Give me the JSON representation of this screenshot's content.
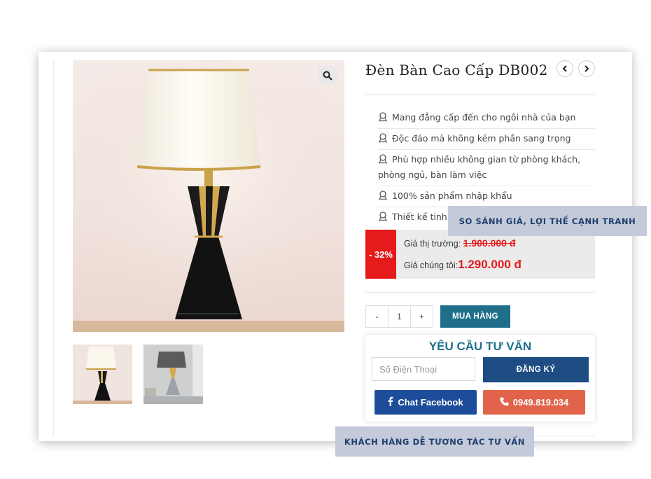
{
  "product": {
    "title": "Đèn Bàn Cao Cấp DB002",
    "prev_icon": "chevron-left-icon",
    "next_icon": "chevron-right-icon",
    "zoom_icon": "search-icon",
    "features": [
      "Mang đẳng cấp đến cho ngôi nhà của bạn",
      "Độc đáo mà không kém phần sang trọng",
      "Phù hợp nhiều không gian từ phòng khách, phòng ngủ, bàn làm việc",
      "100% sản phẩm nhập khẩu",
      "Thiết kế tinh x"
    ],
    "feature_icon": "award-icon"
  },
  "price": {
    "discount": "- 32%",
    "market_label": "Giá thị trường:",
    "market_value": "1.900.000 đ",
    "our_label": "Giá chúng tôi:",
    "our_value": "1.290.000 đ"
  },
  "cart": {
    "minus": "-",
    "quantity": "1",
    "plus": "+",
    "buy_label": "MUA HÀNG"
  },
  "consult": {
    "title": "YÊU CẦU TƯ VẤN",
    "phone_placeholder": "Số Điện Thoại",
    "register_label": "ĐĂNG KÝ",
    "facebook_label": "Chat Facebook",
    "phone_label": "0949.819.034"
  },
  "callouts": {
    "price_compare": "SO SÁNH GIÁ, LỢI THẾ CẠNH TRANH",
    "interaction": "KHÁCH HÀNG DỄ TƯƠNG TÁC TƯ VẤN"
  },
  "colors": {
    "accent": "#1f6f8b",
    "sale_red": "#e61a1a",
    "facebook_blue": "#1d4d9a",
    "call_orange": "#e0634a",
    "callout_bg": "#c4cad9"
  }
}
